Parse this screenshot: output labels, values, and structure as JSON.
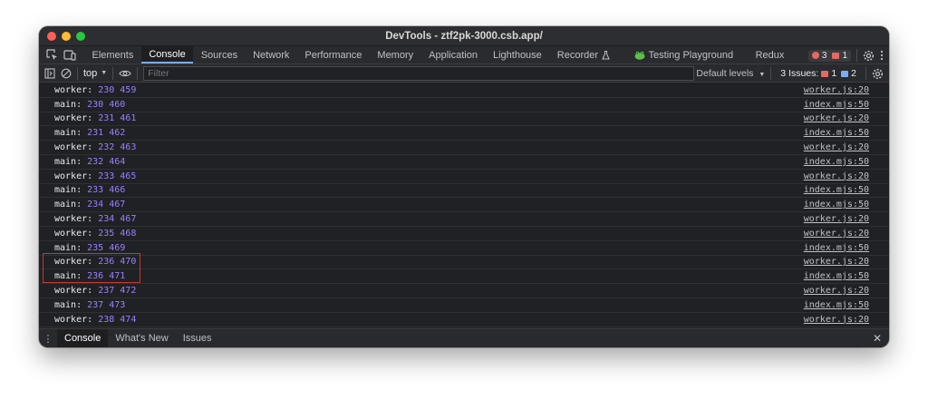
{
  "window": {
    "title": "DevTools - ztf2pk-3000.csb.app/"
  },
  "tabs": [
    {
      "label": "Elements"
    },
    {
      "label": "Console"
    },
    {
      "label": "Sources"
    },
    {
      "label": "Network"
    },
    {
      "label": "Performance"
    },
    {
      "label": "Memory"
    },
    {
      "label": "Application"
    },
    {
      "label": "Lighthouse"
    },
    {
      "label": "Recorder"
    },
    {
      "label": "Testing Playground"
    },
    {
      "label": "Redux"
    }
  ],
  "status": {
    "errors": "3",
    "warnings": "1"
  },
  "toolbar": {
    "context": "top",
    "filter_placeholder": "Filter",
    "levels": "Default levels",
    "issues_label": "3 Issues:",
    "issues_red": "1",
    "issues_blue": "2"
  },
  "log": [
    {
      "kind": "worker:",
      "a": "230",
      "b": "459",
      "src": "worker.js:20"
    },
    {
      "kind": "main:",
      "a": "230",
      "b": "460",
      "src": "index.mjs:50"
    },
    {
      "kind": "worker:",
      "a": "231",
      "b": "461",
      "src": "worker.js:20"
    },
    {
      "kind": "main:",
      "a": "231",
      "b": "462",
      "src": "index.mjs:50"
    },
    {
      "kind": "worker:",
      "a": "232",
      "b": "463",
      "src": "worker.js:20"
    },
    {
      "kind": "main:",
      "a": "232",
      "b": "464",
      "src": "index.mjs:50"
    },
    {
      "kind": "worker:",
      "a": "233",
      "b": "465",
      "src": "worker.js:20"
    },
    {
      "kind": "main:",
      "a": "233",
      "b": "466",
      "src": "index.mjs:50"
    },
    {
      "kind": "main:",
      "a": "234",
      "b": "467",
      "src": "index.mjs:50"
    },
    {
      "kind": "worker:",
      "a": "234",
      "b": "467",
      "src": "worker.js:20"
    },
    {
      "kind": "worker:",
      "a": "235",
      "b": "468",
      "src": "worker.js:20"
    },
    {
      "kind": "main:",
      "a": "235",
      "b": "469",
      "src": "index.mjs:50"
    },
    {
      "kind": "worker:",
      "a": "236",
      "b": "470",
      "src": "worker.js:20"
    },
    {
      "kind": "main:",
      "a": "236",
      "b": "471",
      "src": "index.mjs:50"
    },
    {
      "kind": "worker:",
      "a": "237",
      "b": "472",
      "src": "worker.js:20"
    },
    {
      "kind": "main:",
      "a": "237",
      "b": "473",
      "src": "index.mjs:50"
    },
    {
      "kind": "worker:",
      "a": "238",
      "b": "474",
      "src": "worker.js:20"
    }
  ],
  "drawer": {
    "tabs": [
      {
        "label": "Console"
      },
      {
        "label": "What's New"
      },
      {
        "label": "Issues"
      }
    ]
  },
  "colors": {
    "close": "#ff5f57",
    "minimize": "#febc2e",
    "zoom": "#28c840",
    "accent": "#7cacf8",
    "highlight": "#c43a30"
  }
}
